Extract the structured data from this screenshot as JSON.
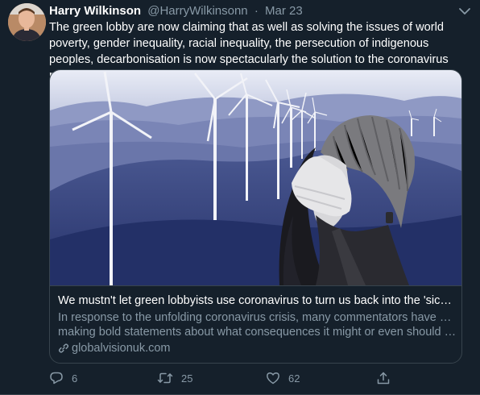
{
  "tweet": {
    "author_name": "Harry Wilkinson",
    "author_handle": "@HarryWilkinsonn",
    "separator": "·",
    "date": "Mar 23",
    "text": "The green lobby are now claiming that as well as solving the issues of world poverty, gender inequality, racial inequality, the persecution of indigenous peoples, decarbonisation is now spectacularly the solution to the coronavirus pandemic too.",
    "avatar_icon": "author-avatar",
    "menu_icon": "chevron-down-icon"
  },
  "card": {
    "image_icon": "wind-turbines-masked-woman-image",
    "title": "We mustn't let green lobbyists use coronavirus to turn us back into the 'sick ma...",
    "description_line1": "In response to the unfolding coronavirus crisis, many commentators have been",
    "description_line2": "making bold statements about what consequences it might or even should hav...",
    "domain": "globalvisionuk.com",
    "link_icon": "link-icon"
  },
  "actions": {
    "reply_icon": "reply-icon",
    "reply_count": "6",
    "retweet_icon": "retweet-icon",
    "retweet_count": "25",
    "like_icon": "heart-icon",
    "like_count": "62",
    "share_icon": "share-icon"
  },
  "colors": {
    "background": "#15202b",
    "secondary_text": "#8899a6",
    "border": "#38444d",
    "image_tint": "#3b4a7a"
  }
}
